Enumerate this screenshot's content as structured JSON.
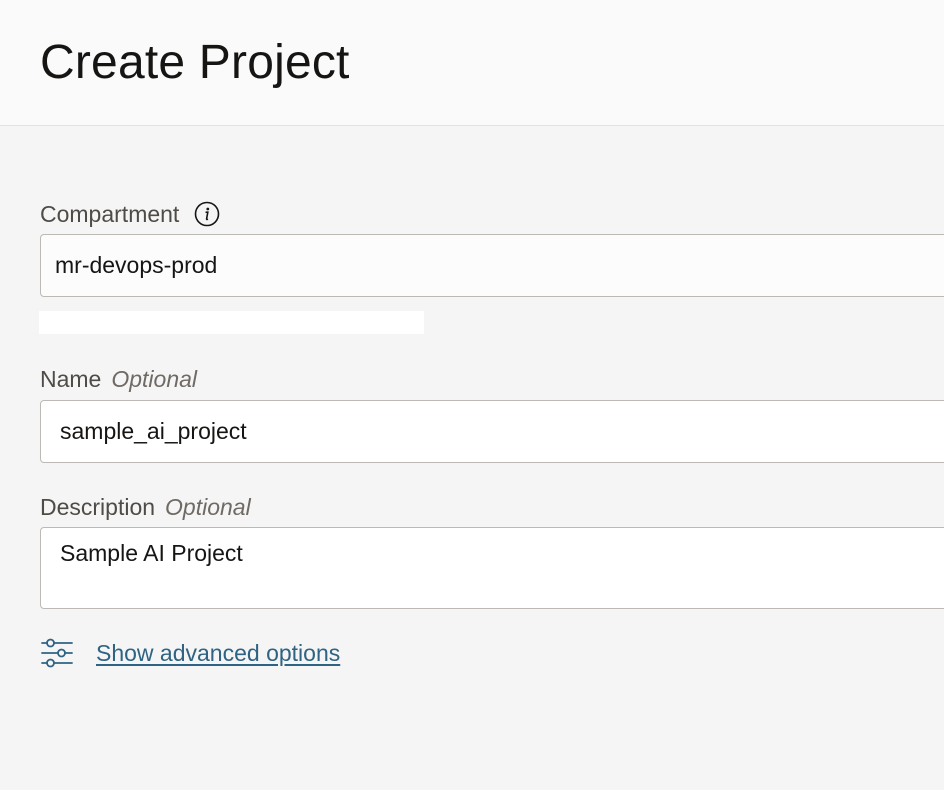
{
  "header": {
    "title": "Create Project"
  },
  "form": {
    "compartment": {
      "label": "Compartment",
      "value": "mr-devops-prod"
    },
    "name": {
      "label": "Name",
      "optional_text": "Optional",
      "value": "sample_ai_project"
    },
    "description": {
      "label": "Description",
      "optional_text": "Optional",
      "value": "Sample AI Project"
    }
  },
  "advanced": {
    "link_text": "Show advanced options"
  },
  "colors": {
    "link": "#2f6383",
    "background": "#f5f5f5",
    "field_border": "#bdb9b4"
  },
  "icons": {
    "compartment_info": "info-icon",
    "advanced": "sliders-icon"
  }
}
